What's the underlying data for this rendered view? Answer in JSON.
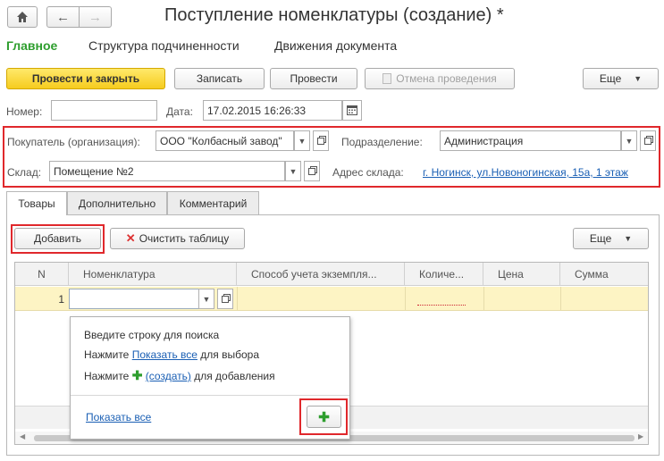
{
  "window": {
    "title": "Поступление номенклатуры (создание) *"
  },
  "nav": {
    "tabs": [
      "Главное",
      "Структура подчиненности",
      "Движения документа"
    ]
  },
  "toolbar": {
    "post_close": "Провести и закрыть",
    "write": "Записать",
    "post": "Провести",
    "cancel_post": "Отмена проведения",
    "more": "Еще"
  },
  "header": {
    "number_label": "Номер:",
    "number_value": "",
    "date_label": "Дата:",
    "date_value": "17.02.2015 16:26:33",
    "buyer_label": "Покупатель (организация):",
    "buyer_value": "ООО \"Колбасный завод\"",
    "division_label": "Подразделение:",
    "division_value": "Администрация",
    "warehouse_label": "Склад:",
    "warehouse_value": "Помещение №2",
    "address_label": "Адрес склада:",
    "address_value": "г. Ногинск, ул.Новоногинская, 15а, 1 этаж"
  },
  "tabs": [
    "Товары",
    "Дополнительно",
    "Комментарий"
  ],
  "table_toolbar": {
    "add": "Добавить",
    "clear": "Очистить таблицу",
    "more": "Еще"
  },
  "table": {
    "columns": [
      "N",
      "Номенклатура",
      "Способ учета экземпля...",
      "Количе...",
      "Цена",
      "Сумма"
    ],
    "rows": [
      {
        "n": "1",
        "item": "",
        "method": "",
        "qty": "",
        "price": "",
        "sum": ""
      }
    ]
  },
  "popup": {
    "line1": "Введите строку для поиска",
    "line2_prefix": "Нажмите ",
    "line2_link": "Показать все",
    "line2_suffix": " для выбора",
    "line3_prefix": "Нажмите ",
    "line3_link": "(создать)",
    "line3_suffix": " для добавления",
    "show_all": "Показать все"
  },
  "colors": {
    "accent_green": "#2e9e2e",
    "highlight_red": "#e0282c",
    "link_blue": "#1a5fb4",
    "primary_yellow": "#f6cc1e",
    "row_highlight": "#fdf4c4"
  }
}
